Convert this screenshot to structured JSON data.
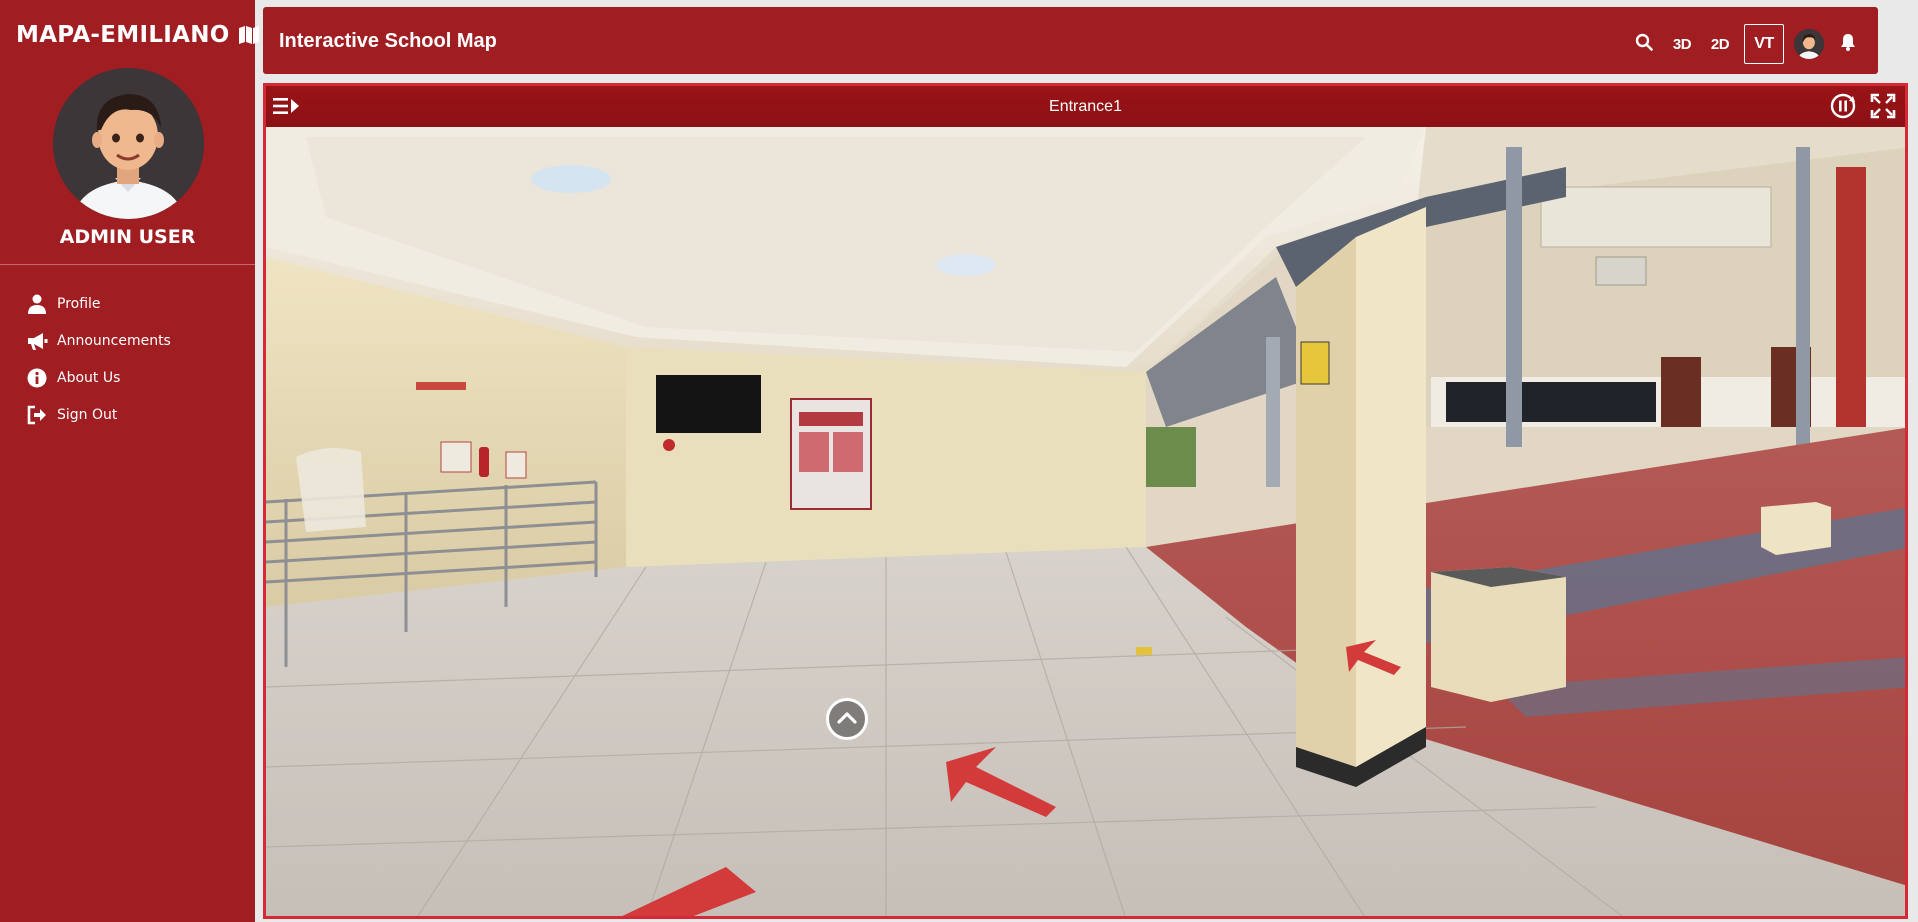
{
  "app": {
    "brand": "MAPA-EMILIANO",
    "brand_icon": "map-icon"
  },
  "user": {
    "name": "ADMIN USER",
    "avatar_icon": "avatar"
  },
  "sidebar": {
    "items": [
      {
        "label": "Profile",
        "icon": "user-icon"
      },
      {
        "label": "Announcements",
        "icon": "megaphone-icon"
      },
      {
        "label": "About Us",
        "icon": "info-icon"
      },
      {
        "label": "Sign Out",
        "icon": "sign-out-icon"
      }
    ]
  },
  "header": {
    "title": "Interactive School Map",
    "tools": {
      "search_icon": "search-icon",
      "view_3d": "3D",
      "view_2d": "2D",
      "view_vt": "VT",
      "bell_icon": "bell-icon"
    }
  },
  "viewer": {
    "scene_title": "Entrance1",
    "icons": [
      "menu-toggle-icon",
      "pause-rotation-icon",
      "fullscreen-icon",
      "chevron-up-icon"
    ]
  },
  "colors": {
    "brand_red": "#a01d22",
    "viewer_border": "#d52a35",
    "header_dark": "#8b1115"
  }
}
